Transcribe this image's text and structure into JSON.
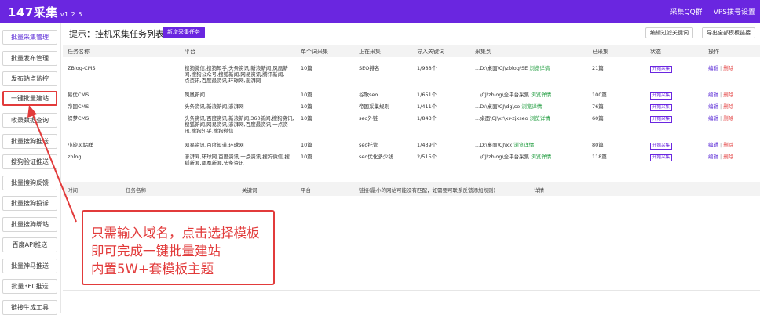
{
  "app": {
    "brand": "147采集",
    "version": "v1.2.5"
  },
  "topnav": [
    "采集QQ群",
    "VPS拨号设置"
  ],
  "sidebar": {
    "items": [
      {
        "label": "批量采集管理"
      },
      {
        "label": "批量发布管理"
      },
      {
        "label": "发布站点监控"
      },
      {
        "label": "一键批量建站"
      },
      {
        "label": "收录数据查询"
      },
      {
        "label": "批量搜狗推送"
      },
      {
        "label": "搜狗验证推送"
      },
      {
        "label": "批量搜狗反馈"
      },
      {
        "label": "批量搜狗投诉"
      },
      {
        "label": "批量搜狗绑站"
      },
      {
        "label": "百度API推送"
      },
      {
        "label": "批量神马推送"
      },
      {
        "label": "批量360推送"
      },
      {
        "label": "链接生成工具"
      }
    ]
  },
  "main": {
    "hint": "提示：挂机采集任务列表",
    "new_task_label": "新增采集任务",
    "btn_filter": "编辑过滤关键词",
    "btn_export": "导出全部模板链接",
    "headers": [
      "任务名称",
      "平台",
      "单个词采集",
      "正在采集",
      "导入关键词",
      "采集到",
      "已采集",
      "状态",
      "操作"
    ],
    "rows": [
      {
        "name": "ZBlog-CMS",
        "platform": "搜狗微信,搜狗知乎,头条资讯,新浪新闻,凤凰新闻,搜狗公众号,搜狐新闻,网易资讯,腾讯新闻,一点资讯,百度最资讯,环球网,澎湃网",
        "per": "10篇",
        "current": "SEO排名",
        "keywords": "1/988个",
        "target": "...D:\\桌面\\CJ\\zblog\\SE",
        "detail": "浏览详情",
        "count": "21篇",
        "status": "开始采集",
        "edit": "编辑",
        "delete": "删除"
      },
      {
        "name": "易优CMS",
        "platform": "凤凰新闻",
        "per": "10篇",
        "current": "谷歌seo",
        "keywords": "1/651个",
        "target": "...\\CJ\\zblog\\全平台采集",
        "detail": "浏览详情",
        "count": "100篇",
        "status": "开始采集",
        "edit": "编辑",
        "delete": "删除"
      },
      {
        "name": "帝国CMS",
        "platform": "头条资讯,新浪新闻,澎湃网",
        "per": "10篇",
        "current": "帝国采集规则",
        "keywords": "1/411个",
        "target": "...D:\\桌面\\CJ\\dg\\se",
        "detail": "浏览详情",
        "count": "76篇",
        "status": "开始采集",
        "edit": "编辑",
        "delete": "删除"
      },
      {
        "name": "织梦CMS",
        "platform": "头条资讯,百度资讯,新浪新闻,360新闻,搜狗资讯,搜狐新闻,网易资讯,澎湃网,百度最资讯,一点资讯,搜狗知乎,搜狗微信",
        "per": "10篇",
        "current": "seo外链",
        "keywords": "1/843个",
        "target": "...桌面\\CJ\\xr\\xr-zjxseo",
        "detail": "浏览详情",
        "count": "60篇",
        "status": "开始采集",
        "edit": "编辑",
        "delete": "删除"
      },
      {
        "name": "小旋风站群",
        "platform": "网易资讯,百度知道,环球网",
        "per": "10篇",
        "current": "seo托管",
        "keywords": "1/439个",
        "target": "...D:\\桌面\\CJ\\xx",
        "detail": "浏览详情",
        "count": "80篇",
        "status": "开始采集",
        "edit": "编辑",
        "delete": "删除"
      },
      {
        "name": "zblog",
        "platform": "澎湃网,环球网,百度资讯,一点资讯,搜狗微信,搜狐新闻,凤凰新闻,头条资讯",
        "per": "10篇",
        "current": "seo优化多少钱",
        "keywords": "2/515个",
        "target": "...\\CJ\\zblog\\全平台采集",
        "detail": "浏览详情",
        "count": "118篇",
        "status": "开始采集",
        "edit": "编辑",
        "delete": "删除"
      }
    ],
    "log_headers": [
      "时间",
      "任务名称",
      "关键词",
      "平台",
      "链接(最小的网站可能没有匹配，如需要可联系反馈添加规则)",
      "详情"
    ]
  },
  "callout": {
    "lines": [
      "只需输入域名，点击选择模板",
      "即可完成一键批量建站",
      "内置5W+套模板主题"
    ]
  },
  "colors": {
    "accent": "#6a26e0",
    "annotation": "#e23b3b",
    "link": "#1a9a3a"
  }
}
